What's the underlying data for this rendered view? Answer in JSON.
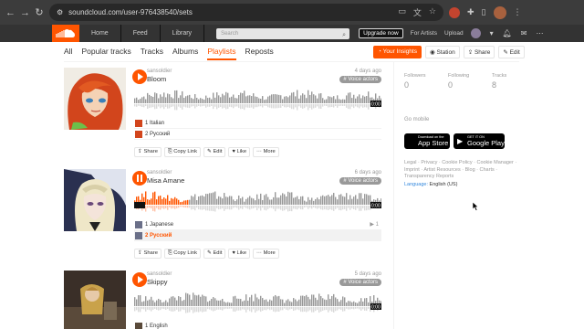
{
  "browser": {
    "url": "soundcloud.com/user-976438540/sets"
  },
  "header": {
    "nav": [
      "Home",
      "Feed",
      "Library"
    ],
    "search_placeholder": "Search",
    "upgrade": "Upgrade now",
    "for_artists": "For Artists",
    "upload": "Upload"
  },
  "tabs": {
    "items": [
      "All",
      "Popular tracks",
      "Tracks",
      "Albums",
      "Playlists",
      "Reposts"
    ],
    "active": "Playlists",
    "insights": "Your Insights",
    "station": "Station",
    "share": "Share",
    "edit": "Edit"
  },
  "playlists": [
    {
      "user": "sansoldier",
      "title": "Bloom",
      "date": "4 days ago",
      "tag": "# Voice actors",
      "duration": "0:00",
      "tracks": [
        {
          "num": "1",
          "name": "Italian",
          "plays": ""
        },
        {
          "num": "2",
          "name": "Русский",
          "plays": ""
        }
      ],
      "playing": false,
      "active_track": -1
    },
    {
      "user": "sansoldier",
      "title": "Misa Amane",
      "date": "6 days ago",
      "tag": "# Voice actors",
      "duration": "0:00",
      "tracks": [
        {
          "num": "1",
          "name": "Japanese",
          "plays": "1"
        },
        {
          "num": "2",
          "name": "Русский",
          "plays": ""
        }
      ],
      "playing": true,
      "active_track": 1
    },
    {
      "user": "sansoldier",
      "title": "Skippy",
      "date": "5 days ago",
      "tag": "# Voice actors",
      "duration": "0:00",
      "tracks": [
        {
          "num": "1",
          "name": "English",
          "plays": ""
        }
      ],
      "playing": false,
      "active_track": -1
    }
  ],
  "actions": [
    "Share",
    "Copy Link",
    "Edit",
    "Like",
    "More"
  ],
  "sidebar": {
    "stats": [
      {
        "label": "Followers",
        "value": "0"
      },
      {
        "label": "Following",
        "value": "0"
      },
      {
        "label": "Tracks",
        "value": "8"
      }
    ],
    "go_mobile": "Go mobile",
    "app_store_small": "Download on the",
    "app_store_big": "App Store",
    "google_small": "GET IT ON",
    "google_big": "Google Play",
    "footer_links": "Legal · Privacy · Cookie Policy · Cookie Manager · Imprint · Artist Resources · Blog · Charts · Transparency Reports",
    "language_label": "Language:",
    "language_value": "English (US)"
  },
  "colors": {
    "accent": "#ff5500",
    "header_bg": "#333333",
    "wave_gray": "#999999"
  }
}
